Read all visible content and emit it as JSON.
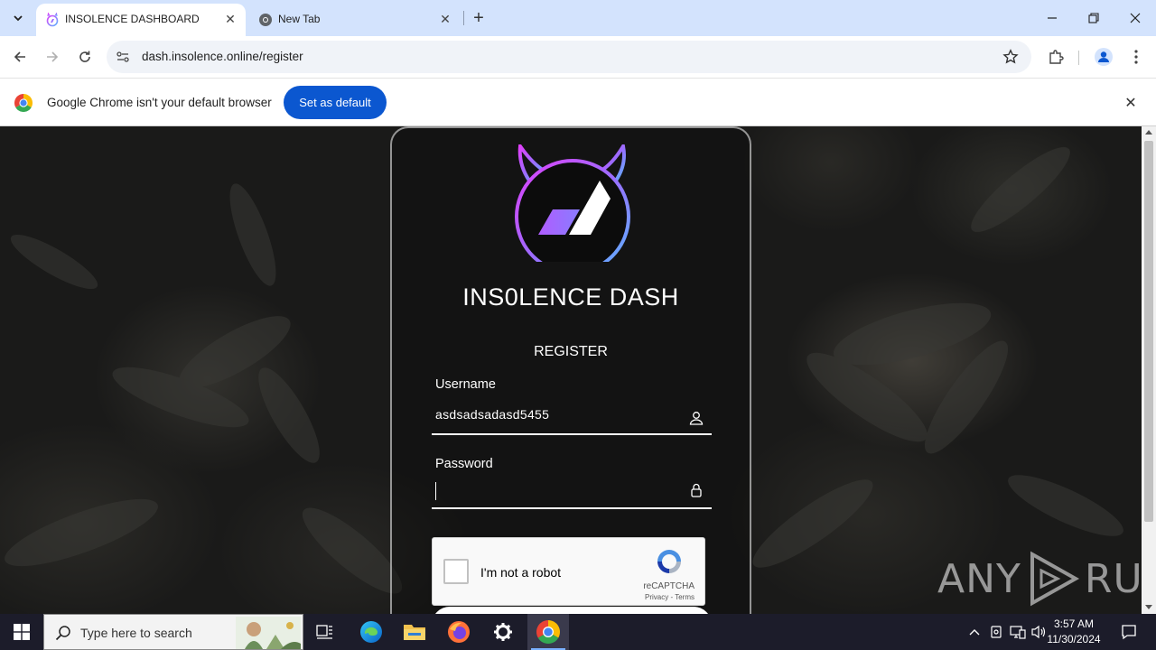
{
  "browser": {
    "tabs": [
      {
        "title": "INSOLENCE DASHBOARD",
        "active": true,
        "favicon": "insolence-favicon"
      },
      {
        "title": "New Tab",
        "active": false,
        "favicon": "chrome-globe-icon"
      }
    ],
    "url": "dash.insolence.online/register",
    "infobar": {
      "message": "Google Chrome isn't your default browser",
      "button": "Set as default"
    }
  },
  "page": {
    "brand": "INS0LENCE DASH",
    "form_title": "REGISTER",
    "username": {
      "label": "Username",
      "value": "asdsadsadasd5455"
    },
    "password": {
      "label": "Password",
      "value": ""
    },
    "captcha": {
      "label": "I'm not a robot",
      "brand": "reCAPTCHA",
      "privacy": "Privacy",
      "separator": "-",
      "terms": "Terms"
    },
    "watermark": {
      "left": "ANY",
      "right": "RUN"
    }
  },
  "taskbar": {
    "search_placeholder": "Type here to search",
    "apps": [
      "task-view",
      "edge",
      "file-explorer",
      "firefox",
      "settings",
      "chrome"
    ],
    "active_app": "chrome",
    "clock": {
      "time": "3:57 AM",
      "date": "11/30/2024"
    }
  },
  "colors": {
    "tab_strip": "#d3e3fd",
    "accent": "#0b57d0",
    "logo_gradient": [
      "#e040fb",
      "#9c6cff",
      "#5ab4ff"
    ],
    "taskbar": "#1c1c2a"
  }
}
